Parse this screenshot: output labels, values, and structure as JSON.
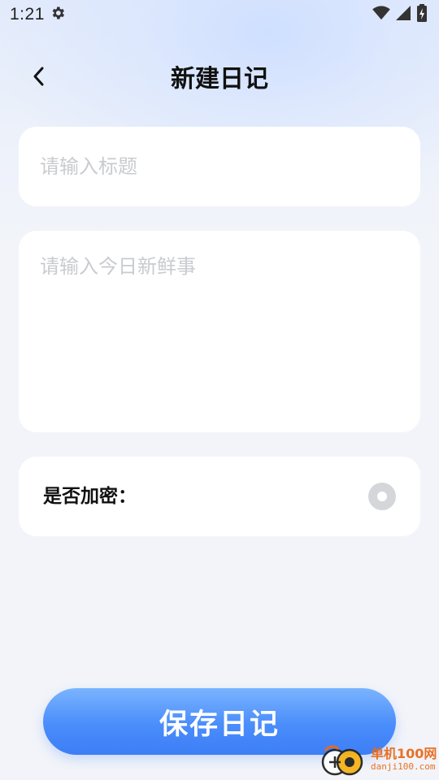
{
  "status_bar": {
    "time": "1:21",
    "icons": [
      "settings-gear-icon",
      "wifi-icon",
      "cell-signal-icon",
      "battery-charging-icon"
    ]
  },
  "header": {
    "back_icon": "chevron-left-icon",
    "title": "新建日记"
  },
  "form": {
    "title_placeholder": "请输入标题",
    "title_value": "",
    "content_placeholder": "请输入今日新鲜事",
    "content_value": "",
    "encrypt_label": "是否加密：",
    "encrypt_enabled": false
  },
  "save_button": {
    "label": "保存日记"
  },
  "watermark": {
    "main": "单机100网",
    "sub": "danji100.com"
  },
  "colors": {
    "accent": "#4a8dfb",
    "background": "#f2f4f9",
    "card": "#ffffff",
    "placeholder": "#c9cbd0"
  }
}
